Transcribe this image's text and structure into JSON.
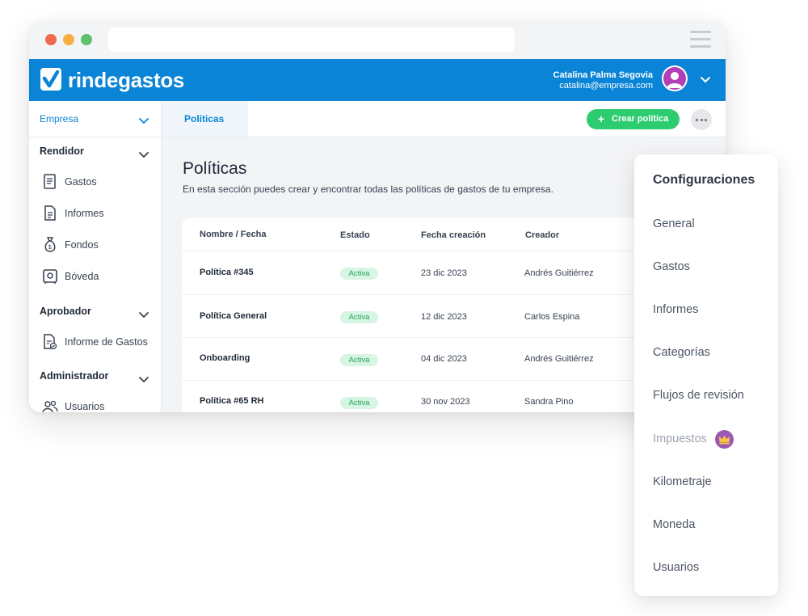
{
  "app": {
    "brand": "rindegastos",
    "user": {
      "name": "Catalina Palma Segovia",
      "email": "catalina@empresa.com"
    }
  },
  "sidebar": {
    "company_select": "Empresa",
    "sections": [
      {
        "title": "Rendidor",
        "items": [
          {
            "label": "Gastos",
            "icon": "receipt-icon"
          },
          {
            "label": "Informes",
            "icon": "document-icon"
          },
          {
            "label": "Fondos",
            "icon": "money-bag-icon"
          },
          {
            "label": "Bóveda",
            "icon": "vault-icon"
          }
        ]
      },
      {
        "title": "Aprobador",
        "items": [
          {
            "label": "Informe de Gastos",
            "icon": "report-check-icon"
          }
        ]
      },
      {
        "title": "Administrador",
        "items": [
          {
            "label": "Usuarios",
            "icon": "users-icon"
          }
        ]
      }
    ]
  },
  "tabs": {
    "active": "Políticas"
  },
  "actions": {
    "create_label": "Crear política"
  },
  "page": {
    "title": "Políticas",
    "description": "En esta sección puedes crear y encontrar todas las políticas de gastos de tu empresa."
  },
  "table": {
    "headers": [
      "Nombre / Fecha",
      "Estado",
      "Fecha creación",
      "Creador"
    ],
    "rows": [
      {
        "name": "Política #345",
        "status": "Activa",
        "date": "23 dic 2023",
        "creator": "Andrés Guitiérrez"
      },
      {
        "name": "Política General",
        "status": "Activa",
        "date": "12 dic 2023",
        "creator": "Carlos Espina"
      },
      {
        "name": "Onboarding",
        "status": "Activa",
        "date": "04 dic 2023",
        "creator": "Andrés Guitiérrez"
      },
      {
        "name": "Política #65 RH",
        "status": "Activa",
        "date": "30 nov 2023",
        "creator": "Sandra Pino"
      }
    ]
  },
  "config_menu": {
    "title": "Configuraciones",
    "items": [
      {
        "label": "General"
      },
      {
        "label": "Gastos"
      },
      {
        "label": "Informes"
      },
      {
        "label": "Categorías"
      },
      {
        "label": "Flujos de revisión"
      },
      {
        "label": "Impuestos",
        "premium": true
      },
      {
        "label": "Kilometraje"
      },
      {
        "label": "Moneda"
      },
      {
        "label": "Usuarios"
      }
    ]
  },
  "colors": {
    "brand_blue": "#0a84d6",
    "success_green": "#2ecc71",
    "premium_purple": "#9b59b6",
    "avatar_magenta": "#b23fb6"
  }
}
